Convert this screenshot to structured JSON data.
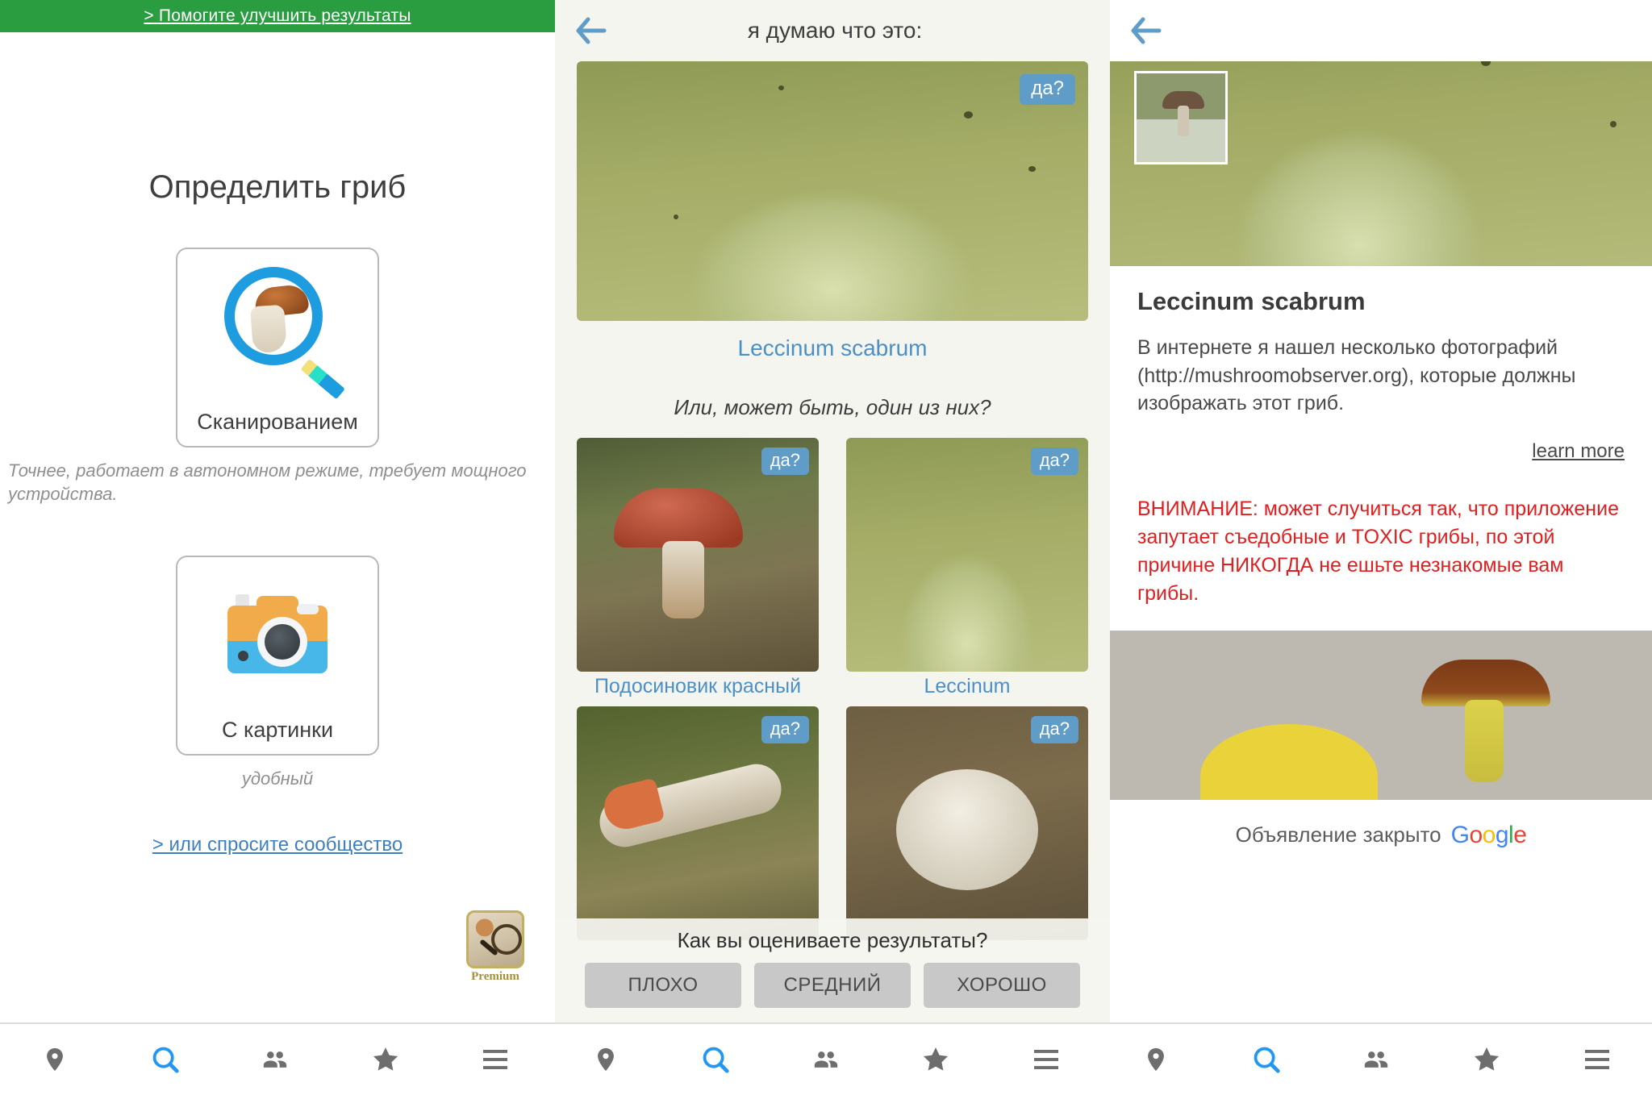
{
  "left": {
    "banner_link": "> Помогите улучшить результаты",
    "title": "Определить гриб",
    "scan_card": {
      "label": "Сканированием",
      "icon": "magnifier-mushroom-icon"
    },
    "scan_hint": "Точнее, работает в автономном режиме, требует мощного устройства.",
    "picture_card": {
      "label": "С картинки",
      "icon": "camera-icon"
    },
    "picture_hint": "удобный",
    "community_link": "> или спросите сообщество",
    "premium_badge": "Premium"
  },
  "middle": {
    "back_icon": "back-arrow-icon",
    "title": "я думаю что это:",
    "hero_yes": "да?",
    "primary_species": "Leccinum scabrum",
    "or_line": "Или, может быть, один из них?",
    "candidates": [
      {
        "label": "Подосиновик красный",
        "yes": "да?"
      },
      {
        "label": "Leccinum",
        "yes": "да?"
      },
      {
        "label": "",
        "yes": "да?"
      },
      {
        "label": "",
        "yes": "да?"
      }
    ],
    "rating_question": "Как вы оцениваете результаты?",
    "rating_buttons": [
      "ПЛОХО",
      "СРЕДНИЙ",
      "ХОРОШО"
    ]
  },
  "right": {
    "back_icon": "back-arrow-icon",
    "title": "Leccinum scabrum",
    "paragraph": "В интернете я нашел несколько фотографий (http://mushroomobserver.org), которые должны изображать этот гриб.",
    "learn_more": "learn more",
    "warning": "ВНИМАНИЕ: может случиться так, что приложение запутает съедобные и TOXIC грибы, по этой причине НИКОГДА не ешьте незнакомые вам грибы.",
    "ad_closed_text": "Объявление закрыто",
    "ad_brand": "Google"
  },
  "navbar": {
    "items": [
      {
        "name": "location-pin-icon",
        "label": ""
      },
      {
        "name": "search-icon",
        "label": ""
      },
      {
        "name": "people-icon",
        "label": ""
      },
      {
        "name": "star-icon",
        "label": ""
      },
      {
        "name": "menu-icon",
        "label": ""
      }
    ],
    "active_index": 1,
    "active_color": "#2196f3",
    "inactive_color": "#6e6e6e"
  }
}
